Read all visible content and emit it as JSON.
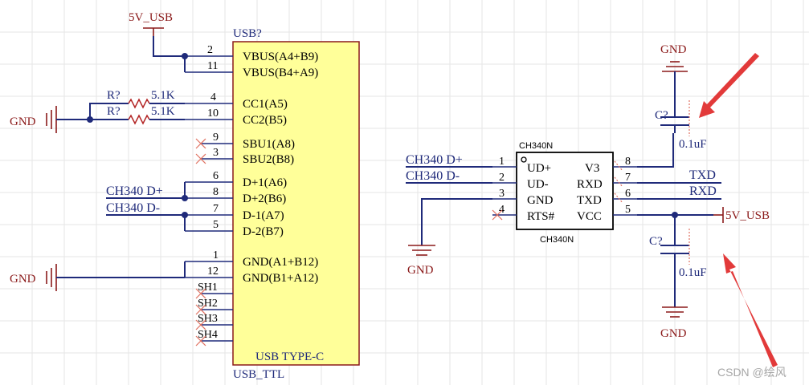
{
  "usb_connector": {
    "designator": "USB?",
    "comment": "USB TYPE-C",
    "footprint": "USB_TTL",
    "pins": [
      {
        "num": "2",
        "name": "VBUS(A4+B9)"
      },
      {
        "num": "11",
        "name": "VBUS(B4+A9)"
      },
      {
        "num": "4",
        "name": "CC1(A5)"
      },
      {
        "num": "10",
        "name": "CC2(B5)"
      },
      {
        "num": "9",
        "name": "SBU1(A8)"
      },
      {
        "num": "3",
        "name": "SBU2(B8)"
      },
      {
        "num": "6",
        "name": "D+1(A6)"
      },
      {
        "num": "8",
        "name": "D+2(B6)"
      },
      {
        "num": "7",
        "name": "D-1(A7)"
      },
      {
        "num": "5",
        "name": "D-2(B7)"
      },
      {
        "num": "1",
        "name": "GND(A1+B12)"
      },
      {
        "num": "12",
        "name": "GND(B1+A12)"
      },
      {
        "num": "SH1",
        "name": ""
      },
      {
        "num": "SH2",
        "name": ""
      },
      {
        "num": "SH3",
        "name": ""
      },
      {
        "num": "SH4",
        "name": ""
      }
    ]
  },
  "resistors": [
    {
      "designator": "R?",
      "value": "5.1K"
    },
    {
      "designator": "R?",
      "value": "5.1K"
    }
  ],
  "ch340": {
    "title": "CH340N",
    "footer": "CH340N",
    "pins": [
      {
        "num": "1",
        "name": "UD+"
      },
      {
        "num": "2",
        "name": "UD-"
      },
      {
        "num": "3",
        "name": "GND"
      },
      {
        "num": "4",
        "name": "RTS#"
      },
      {
        "num": "8",
        "name": "V3"
      },
      {
        "num": "7",
        "name": "RXD"
      },
      {
        "num": "6",
        "name": "TXD"
      },
      {
        "num": "5",
        "name": "VCC"
      }
    ]
  },
  "capacitors": [
    {
      "designator": "C?",
      "value": "0.1uF"
    },
    {
      "designator": "C?",
      "value": "0.1uF"
    }
  ],
  "nets": {
    "usb_5v": "5V_USB",
    "usb_gnd_top": "GND",
    "usb_gnd_bottom": "GND",
    "usb_dp": "CH340 D+",
    "usb_dm": "CH340 D-",
    "ch_dp": "CH340 D+",
    "ch_dm": "CH340 D-",
    "ch_gnd": "GND",
    "txd": "TXD",
    "rxd": "RXD",
    "ch_5v": "5V_USB",
    "cap1_gnd": "GND",
    "cap2_gnd": "GND"
  },
  "watermark": "CSDN @绘风",
  "colors": {
    "body_fill": "#ffff99",
    "body_stroke": "#8b1a1a",
    "wire": "#1f2a7a",
    "power": "#8b1a1a",
    "arrow": "#e23a3a"
  }
}
